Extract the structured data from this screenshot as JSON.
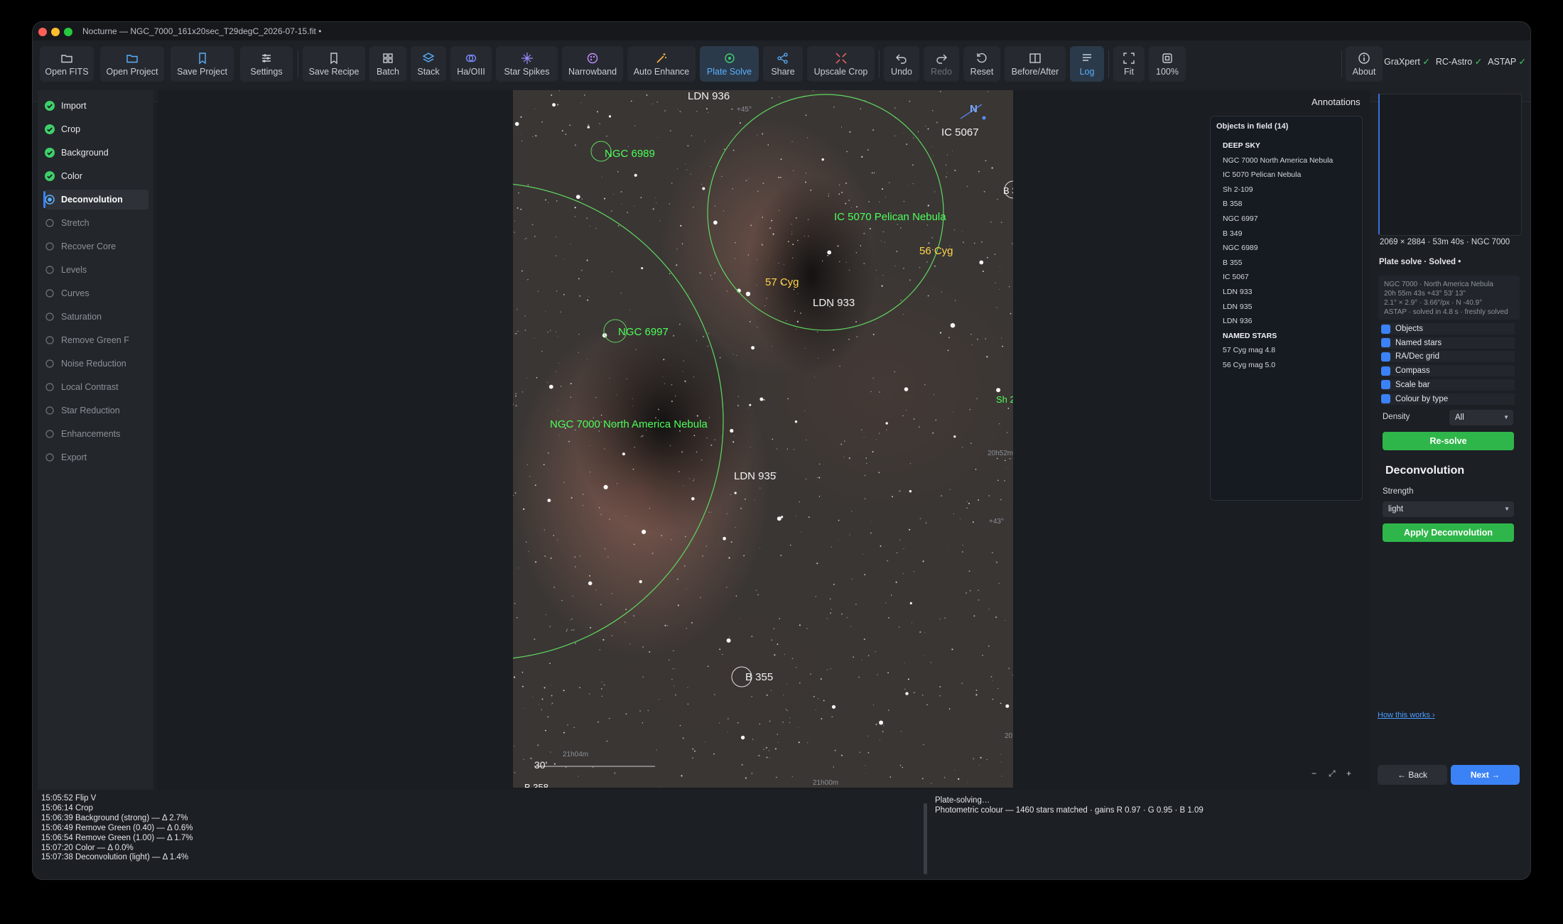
{
  "window": {
    "title": "Nocturne — NGC_7000_161x20sec_T29degC_2026-07-15.fit •"
  },
  "colors": {
    "accent": "#3b82f6",
    "active_text": "#5ab0ff",
    "success": "#2fb64a",
    "annotation_green": "#4dff5a",
    "annotation_yellow": "#ffd54a"
  },
  "toolbar": {
    "open_fits": "Open FITS",
    "open_project": "Open Project",
    "save_project": "Save Project",
    "settings": "Settings",
    "save_recipe": "Save Recipe",
    "batch": "Batch",
    "stack": "Stack",
    "ha_oiii": "Ha/OIII",
    "star_spikes": "Star Spikes",
    "narrowband": "Narrowband",
    "auto_enhance": "Auto Enhance",
    "plate_solve": "Plate Solve",
    "share": "Share",
    "upscale_crop": "Upscale Crop",
    "undo": "Undo",
    "redo": "Redo",
    "reset": "Reset",
    "before_after": "Before/After",
    "log": "Log",
    "fit": "Fit",
    "zoom": "100%",
    "about": "About"
  },
  "engines": [
    {
      "name": "GraXpert",
      "status": "✓"
    },
    {
      "name": "RC-Astro",
      "status": "✓"
    },
    {
      "name": "ASTAP",
      "status": "✓"
    }
  ],
  "steps": [
    {
      "label": "Import",
      "state": "done"
    },
    {
      "label": "Crop",
      "state": "done"
    },
    {
      "label": "Background",
      "state": "done"
    },
    {
      "label": "Color",
      "state": "done"
    },
    {
      "label": "Deconvolution",
      "state": "current"
    },
    {
      "label": "Stretch",
      "state": "pending"
    },
    {
      "label": "Recover Core",
      "state": "pending"
    },
    {
      "label": "Levels",
      "state": "pending"
    },
    {
      "label": "Curves",
      "state": "pending"
    },
    {
      "label": "Saturation",
      "state": "pending"
    },
    {
      "label": "Remove Green F",
      "state": "pending"
    },
    {
      "label": "Noise Reduction",
      "state": "pending"
    },
    {
      "label": "Local Contrast",
      "state": "pending"
    },
    {
      "label": "Star Reduction",
      "state": "pending"
    },
    {
      "label": "Enhancements",
      "state": "pending"
    },
    {
      "label": "Export",
      "state": "pending"
    }
  ],
  "image_annotations": {
    "ldn936": "LDN 936",
    "ngc6989": "NGC 6989",
    "ic5067": "IC 5067",
    "ic5070": "IC 5070  Pelican Nebula",
    "cyg56": "56 Cyg",
    "cyg57": "57 Cyg",
    "ldn933": "LDN 933",
    "ngc6997": "NGC 6997",
    "ngc7000": "NGC 7000  North America Nebula",
    "ldn935": "LDN 935",
    "b355": "B 355",
    "b3": "B 3",
    "sh2": "Sh 2",
    "b358": "B 358",
    "north": "N",
    "scale": "30'",
    "grid_45": "+45°",
    "grid_43": "+43°",
    "grid_20h52m": "20h52m",
    "grid_21h04m": "21h04m",
    "grid_21h00m": "21h00m",
    "grid_20": "20"
  },
  "annotations_panel": {
    "title": "Annotations",
    "header": "Objects in field (14)",
    "rows": [
      {
        "text": "DEEP SKY",
        "section": true
      },
      {
        "text": "NGC 7000  North America Nebula"
      },
      {
        "text": "IC 5070  Pelican Nebula"
      },
      {
        "text": "Sh 2-109"
      },
      {
        "text": "B 358"
      },
      {
        "text": "NGC 6997"
      },
      {
        "text": "B 349"
      },
      {
        "text": "NGC 6989"
      },
      {
        "text": "B 355"
      },
      {
        "text": "IC 5067"
      },
      {
        "text": "LDN 933"
      },
      {
        "text": "LDN 935"
      },
      {
        "text": "LDN 936"
      },
      {
        "text": "NAMED STARS",
        "section": true
      },
      {
        "text": "57 Cyg   mag 4.8"
      },
      {
        "text": "56 Cyg   mag 5.0"
      }
    ]
  },
  "right_panel": {
    "meta": "2069 × 2884  ·  53m 40s  ·  NGC 7000",
    "plate_solve_title": "Plate solve · Solved •",
    "solve_lines": [
      "NGC 7000 · North America Nebula",
      "20h 55m 43s   +43° 53' 13\"",
      "2.1° × 2.9°  ·  3.66\"/px  ·  N -40.9°",
      "ASTAP · solved in 4.8 s · freshly solved"
    ],
    "checkboxes": [
      "Objects",
      "Named stars",
      "RA/Dec grid",
      "Compass",
      "Scale bar",
      "Colour by type"
    ],
    "density_label": "Density",
    "density_value": "All",
    "resolve_button": "Re-solve",
    "decon_title": "Deconvolution",
    "strength_label": "Strength",
    "strength_value": "light",
    "apply_button": "Apply Deconvolution",
    "how_link": "How this works ›",
    "back_button": "← Back",
    "next_button": "Next →"
  },
  "zoom_controls": {
    "minus": "−",
    "fit": "⤢",
    "plus": "+"
  },
  "log": [
    "15:05:52  Flip V",
    "15:06:14  Crop",
    "15:06:39  Background (strong)  —  Δ 2.7%",
    "15:06:49  Remove Green (0.40)  —  Δ 0.6%",
    "15:06:54  Remove Green (1.00)  —  Δ 1.7%",
    "15:07:20  Color  —  Δ 0.0%",
    "15:07:38  Deconvolution (light)  —  Δ 1.4%"
  ],
  "status": [
    "Plate-solving…",
    "Photometric colour — 1460 stars matched · gains R 0.97 · G 0.95 · B 1.09"
  ]
}
